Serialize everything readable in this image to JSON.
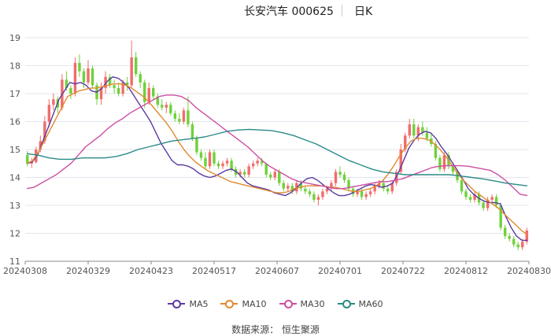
{
  "title": {
    "name": "长安汽车 000625",
    "period": "日K"
  },
  "source": "数据来源： 恒生聚源",
  "colors": {
    "up": "#f26b6b",
    "down": "#6fd13a",
    "grid": "#e3e6ee",
    "axis": "#8a8a8a"
  },
  "chart_data": {
    "type": "candlestick",
    "ylim": [
      11,
      19
    ],
    "yticks": [
      11,
      12,
      13,
      14,
      15,
      16,
      17,
      18,
      19
    ],
    "xticks": [
      "20240308",
      "20240329",
      "20240423",
      "20240517",
      "20240607",
      "20240701",
      "20240722",
      "20240812",
      "20240830"
    ],
    "grid": true,
    "legend_position": "bottom",
    "candles": [
      [
        14.8,
        14.95,
        14.4,
        14.5
      ],
      [
        14.5,
        14.7,
        14.35,
        14.55
      ],
      [
        14.55,
        15.1,
        14.5,
        15.0
      ],
      [
        15.0,
        15.5,
        14.9,
        15.3
      ],
      [
        15.3,
        16.2,
        15.2,
        16.0
      ],
      [
        16.0,
        16.8,
        15.8,
        16.6
      ],
      [
        16.6,
        17.0,
        16.4,
        16.8
      ],
      [
        16.8,
        16.9,
        16.3,
        16.5
      ],
      [
        16.5,
        17.7,
        16.4,
        17.5
      ],
      [
        17.5,
        17.8,
        17.1,
        17.2
      ],
      [
        17.2,
        17.3,
        16.8,
        17.0
      ],
      [
        17.0,
        18.3,
        16.9,
        18.1
      ],
      [
        18.1,
        18.4,
        17.6,
        17.8
      ],
      [
        17.8,
        17.9,
        17.2,
        17.4
      ],
      [
        17.4,
        18.2,
        17.3,
        17.9
      ],
      [
        17.9,
        18.0,
        17.2,
        17.3
      ],
      [
        17.3,
        17.4,
        16.6,
        16.8
      ],
      [
        16.8,
        17.4,
        16.6,
        17.2
      ],
      [
        17.2,
        17.8,
        17.0,
        17.6
      ],
      [
        17.6,
        17.7,
        17.2,
        17.3
      ],
      [
        17.3,
        17.5,
        17.0,
        17.2
      ],
      [
        17.2,
        17.4,
        16.9,
        17.0
      ],
      [
        17.0,
        17.5,
        16.9,
        17.4
      ],
      [
        17.4,
        17.6,
        17.1,
        17.3
      ],
      [
        17.3,
        18.9,
        17.2,
        18.3
      ],
      [
        18.3,
        18.5,
        17.6,
        17.7
      ],
      [
        17.7,
        17.8,
        17.2,
        17.4
      ],
      [
        17.4,
        17.5,
        16.5,
        16.7
      ],
      [
        16.7,
        17.4,
        16.6,
        17.2
      ],
      [
        17.2,
        17.3,
        16.8,
        16.9
      ],
      [
        16.9,
        17.0,
        16.5,
        16.6
      ],
      [
        16.6,
        16.8,
        16.4,
        16.5
      ],
      [
        16.5,
        16.7,
        16.3,
        16.6
      ],
      [
        16.6,
        16.7,
        16.2,
        16.3
      ],
      [
        16.3,
        16.4,
        16.0,
        16.1
      ],
      [
        16.1,
        16.3,
        15.9,
        16.0
      ],
      [
        16.0,
        16.5,
        15.9,
        16.4
      ],
      [
        16.4,
        16.9,
        15.8,
        15.9
      ],
      [
        15.9,
        16.0,
        15.3,
        15.4
      ],
      [
        15.4,
        15.5,
        14.8,
        14.9
      ],
      [
        14.9,
        15.0,
        14.6,
        14.7
      ],
      [
        14.7,
        14.9,
        14.3,
        14.4
      ],
      [
        14.4,
        15.0,
        14.3,
        14.9
      ],
      [
        14.9,
        15.0,
        14.4,
        14.5
      ],
      [
        14.5,
        14.6,
        14.3,
        14.4
      ],
      [
        14.4,
        14.6,
        14.3,
        14.5
      ],
      [
        14.5,
        14.7,
        14.4,
        14.6
      ],
      [
        14.6,
        14.7,
        14.2,
        14.3
      ],
      [
        14.3,
        14.4,
        14.0,
        14.1
      ],
      [
        14.1,
        14.3,
        14.0,
        14.2
      ],
      [
        14.2,
        14.3,
        14.0,
        14.1
      ],
      [
        14.1,
        14.5,
        14.0,
        14.4
      ],
      [
        14.4,
        14.6,
        14.3,
        14.5
      ],
      [
        14.5,
        14.7,
        14.4,
        14.6
      ],
      [
        14.6,
        14.7,
        14.4,
        14.5
      ],
      [
        14.5,
        14.4,
        14.0,
        14.1
      ],
      [
        14.1,
        14.2,
        13.9,
        14.0
      ],
      [
        14.0,
        14.3,
        13.9,
        14.2
      ],
      [
        14.2,
        14.3,
        13.7,
        13.8
      ],
      [
        13.8,
        13.9,
        13.5,
        13.6
      ],
      [
        13.6,
        13.8,
        13.5,
        13.7
      ],
      [
        13.7,
        13.8,
        13.4,
        13.5
      ],
      [
        13.5,
        13.9,
        13.4,
        13.8
      ],
      [
        13.8,
        13.9,
        13.5,
        13.6
      ],
      [
        13.6,
        13.7,
        13.4,
        13.5
      ],
      [
        13.5,
        13.6,
        13.3,
        13.4
      ],
      [
        13.4,
        13.5,
        13.1,
        13.2
      ],
      [
        13.2,
        13.4,
        13.0,
        13.3
      ],
      [
        13.3,
        13.6,
        13.2,
        13.5
      ],
      [
        13.5,
        13.7,
        13.4,
        13.6
      ],
      [
        13.6,
        13.9,
        13.5,
        13.8
      ],
      [
        13.8,
        14.3,
        13.7,
        14.2
      ],
      [
        14.2,
        14.4,
        14.0,
        14.1
      ],
      [
        14.1,
        14.2,
        13.8,
        13.9
      ],
      [
        13.9,
        14.0,
        13.5,
        13.6
      ],
      [
        13.6,
        13.7,
        13.3,
        13.4
      ],
      [
        13.4,
        13.6,
        13.3,
        13.5
      ],
      [
        13.5,
        13.6,
        13.2,
        13.3
      ],
      [
        13.3,
        13.5,
        13.2,
        13.4
      ],
      [
        13.4,
        13.6,
        13.3,
        13.5
      ],
      [
        13.5,
        13.8,
        13.4,
        13.7
      ],
      [
        13.7,
        13.9,
        13.6,
        13.8
      ],
      [
        13.8,
        13.9,
        13.5,
        13.6
      ],
      [
        13.6,
        13.7,
        13.4,
        13.5
      ],
      [
        13.5,
        13.9,
        13.4,
        13.8
      ],
      [
        13.8,
        14.3,
        13.7,
        14.2
      ],
      [
        14.2,
        15.2,
        14.1,
        15.0
      ],
      [
        15.0,
        15.6,
        14.9,
        15.5
      ],
      [
        15.5,
        16.1,
        15.4,
        15.9
      ],
      [
        15.9,
        16.1,
        15.4,
        15.5
      ],
      [
        15.5,
        15.9,
        15.3,
        15.8
      ],
      [
        15.8,
        16.0,
        15.5,
        15.6
      ],
      [
        15.6,
        15.8,
        15.3,
        15.4
      ],
      [
        15.4,
        15.6,
        15.1,
        15.2
      ],
      [
        15.2,
        15.3,
        14.6,
        14.7
      ],
      [
        14.7,
        14.8,
        14.2,
        14.3
      ],
      [
        14.3,
        14.9,
        14.2,
        14.8
      ],
      [
        14.8,
        14.9,
        14.3,
        14.4
      ],
      [
        14.4,
        14.5,
        14.1,
        14.2
      ],
      [
        14.2,
        14.3,
        13.8,
        13.9
      ],
      [
        13.9,
        14.0,
        13.4,
        13.5
      ],
      [
        13.5,
        13.6,
        13.2,
        13.3
      ],
      [
        13.3,
        13.4,
        13.1,
        13.2
      ],
      [
        13.2,
        13.5,
        13.1,
        13.4
      ],
      [
        13.4,
        13.5,
        13.0,
        13.1
      ],
      [
        13.1,
        13.2,
        12.8,
        12.9
      ],
      [
        12.9,
        13.3,
        12.8,
        13.2
      ],
      [
        13.2,
        13.4,
        13.1,
        13.3
      ],
      [
        13.3,
        13.4,
        12.9,
        13.0
      ],
      [
        13.0,
        13.1,
        12.1,
        12.2
      ],
      [
        12.2,
        12.3,
        11.8,
        11.9
      ],
      [
        11.9,
        12.0,
        11.7,
        11.8
      ],
      [
        11.8,
        11.9,
        11.5,
        11.6
      ],
      [
        11.6,
        11.7,
        11.4,
        11.5
      ],
      [
        11.5,
        11.8,
        11.4,
        11.7
      ],
      [
        11.7,
        12.2,
        11.6,
        12.1
      ]
    ],
    "series": [
      {
        "name": "MA5",
        "color": "#5b3aa0",
        "values": [
          14.5,
          14.55,
          14.8,
          15.3,
          15.8,
          16.3,
          16.8,
          17.1,
          17.4,
          17.35,
          17.4,
          17.3,
          17.1,
          17.05,
          17.2,
          17.45,
          17.6,
          17.55,
          17.4,
          17.2,
          16.9,
          16.6,
          16.3,
          16.0,
          15.6,
          15.2,
          14.9,
          14.6,
          14.45,
          14.45,
          14.4,
          14.3,
          14.15,
          14.05,
          14.0,
          14.05,
          14.15,
          14.25,
          14.3,
          14.2,
          14.0,
          13.8,
          13.7,
          13.65,
          13.6,
          13.55,
          13.45,
          13.4,
          13.35,
          13.45,
          13.6,
          13.8,
          13.95,
          14.0,
          13.9,
          13.75,
          13.6,
          13.45,
          13.35,
          13.35,
          13.4,
          13.5,
          13.6,
          13.7,
          13.75,
          13.7,
          13.65,
          13.7,
          13.8,
          14.15,
          14.6,
          15.05,
          15.35,
          15.55,
          15.65,
          15.6,
          15.4,
          15.1,
          14.85,
          14.55,
          14.25,
          13.95,
          13.6,
          13.4,
          13.25,
          13.15,
          13.1,
          13.1,
          13.05,
          12.6,
          12.2,
          11.9,
          11.75,
          11.75
        ]
      },
      {
        "name": "MA10",
        "color": "#e08a2e",
        "values": [
          14.5,
          14.6,
          14.9,
          15.3,
          15.7,
          16.1,
          16.5,
          16.9,
          17.0,
          17.1,
          17.15,
          17.2,
          17.2,
          17.25,
          17.3,
          17.35,
          17.35,
          17.3,
          17.2,
          17.05,
          16.9,
          16.7,
          16.45,
          16.2,
          15.95,
          15.65,
          15.3,
          15.0,
          14.75,
          14.55,
          14.4,
          14.25,
          14.15,
          14.05,
          13.95,
          13.85,
          13.8,
          13.75,
          13.7,
          13.65,
          13.6,
          13.55,
          13.5,
          13.45,
          13.45,
          13.5,
          13.6,
          13.65,
          13.7,
          13.7,
          13.7,
          13.7,
          13.65,
          13.65,
          13.6,
          13.55,
          13.5,
          13.5,
          13.55,
          13.6,
          13.7,
          13.85,
          14.1,
          14.4,
          14.75,
          15.05,
          15.3,
          15.4,
          15.4,
          15.35,
          15.2,
          15.0,
          14.75,
          14.45,
          14.15,
          13.9,
          13.7,
          13.5,
          13.35,
          13.2,
          13.05,
          12.9,
          12.7,
          12.5,
          12.3,
          12.1,
          11.95
        ]
      },
      {
        "name": "MA30",
        "color": "#cc4ea3",
        "values": [
          13.6,
          13.65,
          13.8,
          13.95,
          14.1,
          14.3,
          14.5,
          14.8,
          15.1,
          15.3,
          15.5,
          15.75,
          15.95,
          16.1,
          16.3,
          16.45,
          16.6,
          16.75,
          16.9,
          16.95,
          16.95,
          16.9,
          16.75,
          16.5,
          16.3,
          16.1,
          15.9,
          15.7,
          15.5,
          15.3,
          15.1,
          14.85,
          14.6,
          14.4,
          14.25,
          14.1,
          13.95,
          13.85,
          13.8,
          13.75,
          13.7,
          13.65,
          13.6,
          13.6,
          13.65,
          13.7,
          13.75,
          13.8,
          13.85,
          13.85,
          13.9,
          13.95,
          14.05,
          14.15,
          14.25,
          14.35,
          14.4,
          14.42,
          14.42,
          14.42,
          14.4,
          14.35,
          14.3,
          14.25,
          14.1,
          13.9,
          13.65,
          13.4,
          13.35
        ]
      },
      {
        "name": "MA60",
        "color": "#2a8a86",
        "values": [
          14.85,
          14.8,
          14.7,
          14.65,
          14.65,
          14.7,
          14.7,
          14.7,
          14.75,
          14.85,
          15.0,
          15.1,
          15.2,
          15.3,
          15.35,
          15.4,
          15.45,
          15.55,
          15.65,
          15.7,
          15.72,
          15.7,
          15.68,
          15.6,
          15.5,
          15.35,
          15.2,
          15.0,
          14.8,
          14.6,
          14.45,
          14.3,
          14.2,
          14.15,
          14.1,
          14.1,
          14.1,
          14.1,
          14.1,
          14.05,
          14.0,
          13.95,
          13.88,
          13.8,
          13.75,
          13.7
        ]
      }
    ]
  }
}
